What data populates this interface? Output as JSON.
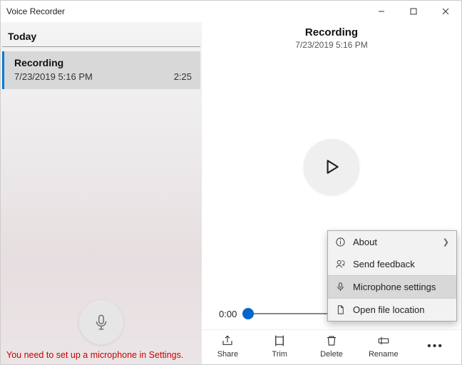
{
  "app": {
    "title": "Voice Recorder"
  },
  "list": {
    "section": "Today",
    "item": {
      "name": "Recording",
      "timestamp": "7/23/2019 5:16 PM",
      "duration": "2:25"
    }
  },
  "warning": "You need to set up a microphone in Settings.",
  "detail": {
    "title": "Recording",
    "timestamp": "7/23/2019 5:16 PM"
  },
  "playback": {
    "position": "0:00"
  },
  "toolbar": {
    "share": "Share",
    "trim": "Trim",
    "delete": "Delete",
    "rename": "Rename",
    "more": "•••"
  },
  "menu": {
    "about": "About",
    "feedback": "Send feedback",
    "mic": "Microphone settings",
    "open": "Open file location"
  }
}
